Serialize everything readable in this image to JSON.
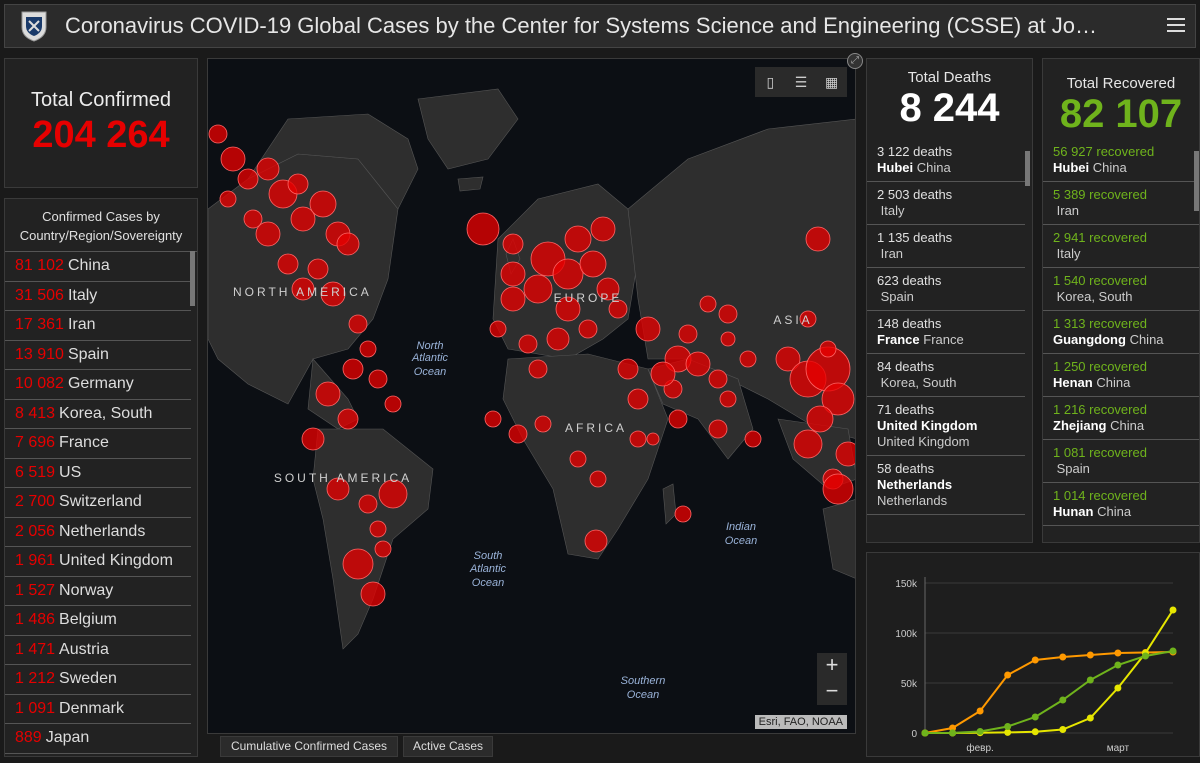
{
  "header": {
    "title": "Coronavirus COVID-19 Global Cases by the Center for Systems Science and Engineering (CSSE) at Jo…"
  },
  "total_confirmed": {
    "label": "Total Confirmed",
    "value": "204 264"
  },
  "country_list": {
    "header": "Confirmed Cases by Country/Region/Sovereignty",
    "items": [
      {
        "num": "81 102",
        "name": "China"
      },
      {
        "num": "31 506",
        "name": "Italy"
      },
      {
        "num": "17 361",
        "name": "Iran"
      },
      {
        "num": "13 910",
        "name": "Spain"
      },
      {
        "num": "10 082",
        "name": "Germany"
      },
      {
        "num": "8 413",
        "name": "Korea, South"
      },
      {
        "num": "7 696",
        "name": "France"
      },
      {
        "num": "6 519",
        "name": "US"
      },
      {
        "num": "2 700",
        "name": "Switzerland"
      },
      {
        "num": "2 056",
        "name": "Netherlands"
      },
      {
        "num": "1 961",
        "name": "United Kingdom"
      },
      {
        "num": "1 527",
        "name": "Norway"
      },
      {
        "num": "1 486",
        "name": "Belgium"
      },
      {
        "num": "1 471",
        "name": "Austria"
      },
      {
        "num": "1 212",
        "name": "Sweden"
      },
      {
        "num": "1 091",
        "name": "Denmark"
      },
      {
        "num": "889",
        "name": "Japan"
      }
    ]
  },
  "map": {
    "labels": {
      "north_america": "NORTH AMERICA",
      "south_america": "SOUTH AMERICA",
      "europe": "EUROPE",
      "africa": "AFRICA",
      "asia": "ASIA",
      "n_atlantic_1": "North",
      "n_atlantic_2": "Atlantic",
      "n_atlantic_3": "Ocean",
      "s_atlantic_1": "South",
      "s_atlantic_2": "Atlantic",
      "s_atlantic_3": "Ocean",
      "indian_1": "Indian",
      "indian_2": "Ocean",
      "southern_1": "Southern",
      "southern_2": "Ocean"
    },
    "zoom_in": "+",
    "zoom_out": "−",
    "attribution": "Esri, FAO, NOAA",
    "bubble_color": "#e60000"
  },
  "tabs": [
    {
      "label": "Cumulative Confirmed Cases"
    },
    {
      "label": "Active Cases"
    }
  ],
  "deaths": {
    "label": "Total Deaths",
    "value": "8 244",
    "items": [
      {
        "count": "3 122 deaths",
        "bold": "Hubei",
        "place": "China"
      },
      {
        "count": "2 503 deaths",
        "bold": "",
        "place": "Italy"
      },
      {
        "count": "1 135 deaths",
        "bold": "",
        "place": "Iran"
      },
      {
        "count": "623 deaths",
        "bold": "",
        "place": "Spain"
      },
      {
        "count": "148 deaths",
        "bold": "France",
        "place": "France"
      },
      {
        "count": "84 deaths",
        "bold": "",
        "place": "Korea, South"
      },
      {
        "count": "71 deaths",
        "bold": "United Kingdom",
        "place": "United Kingdom"
      },
      {
        "count": "58 deaths",
        "bold": "Netherlands",
        "place": "Netherlands"
      }
    ]
  },
  "recovered": {
    "label": "Total Recovered",
    "value": "82 107",
    "color": "#6fb31c",
    "items": [
      {
        "count": "56 927 recovered",
        "bold": "Hubei",
        "place": "China"
      },
      {
        "count": "5 389 recovered",
        "bold": "",
        "place": "Iran"
      },
      {
        "count": "2 941 recovered",
        "bold": "",
        "place": "Italy"
      },
      {
        "count": "1 540 recovered",
        "bold": "",
        "place": "Korea, South"
      },
      {
        "count": "1 313 recovered",
        "bold": "Guangdong",
        "place": "China"
      },
      {
        "count": "1 250 recovered",
        "bold": "Henan",
        "place": "China"
      },
      {
        "count": "1 216 recovered",
        "bold": "Zhejiang",
        "place": "China"
      },
      {
        "count": "1 081 recovered",
        "bold": "",
        "place": "Spain"
      },
      {
        "count": "1 014 recovered",
        "bold": "Hunan",
        "place": "China"
      }
    ]
  },
  "chart_data": {
    "type": "line",
    "x_tick_labels": [
      "февр.",
      "март"
    ],
    "y_tick_labels": [
      "150k",
      "100k",
      "50k",
      "0"
    ],
    "ylim": [
      0,
      150000
    ],
    "x": [
      "2020-01-22",
      "2020-01-29",
      "2020-02-05",
      "2020-02-12",
      "2020-02-19",
      "2020-02-26",
      "2020-03-04",
      "2020-03-11",
      "2020-03-15",
      "2020-03-18"
    ],
    "series": [
      {
        "color": "#ff9900",
        "values": [
          0,
          5000,
          22000,
          58000,
          73000,
          76000,
          78000,
          80000,
          80500,
          81000
        ]
      },
      {
        "color": "#e6e600",
        "values": [
          0,
          0,
          300,
          600,
          1200,
          3500,
          15000,
          45000,
          80000,
          123000
        ]
      },
      {
        "color": "#6fb31c",
        "values": [
          0,
          100,
          1500,
          6500,
          16000,
          33000,
          53000,
          68000,
          77000,
          82000
        ]
      }
    ]
  }
}
